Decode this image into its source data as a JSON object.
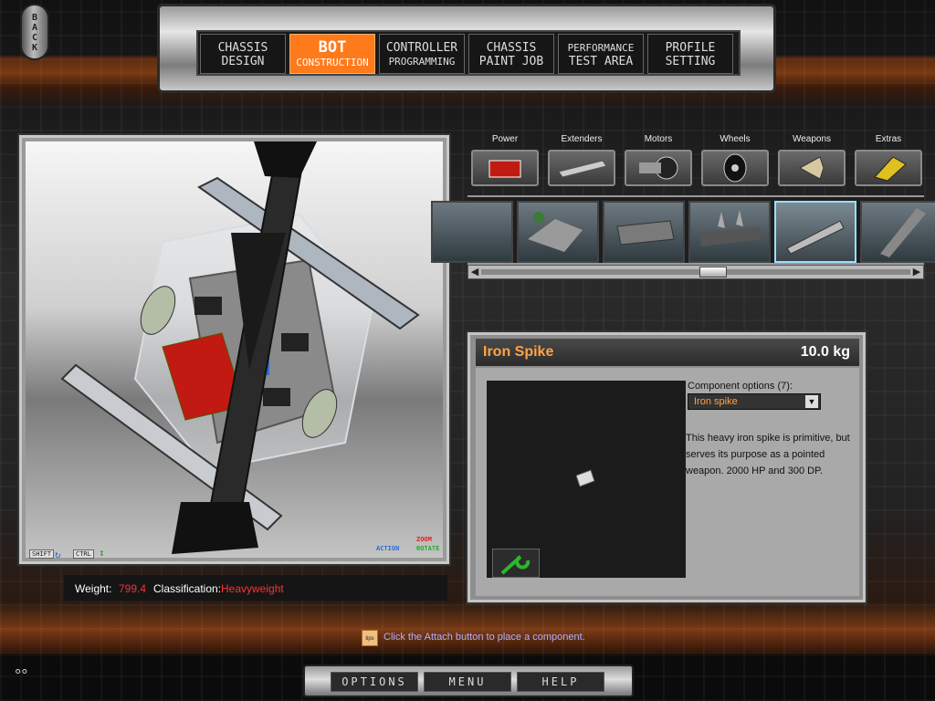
{
  "back_label": "BACK",
  "top_nav": {
    "tabs": [
      {
        "line1": "CHASSIS",
        "line2": "DESIGN",
        "active": false
      },
      {
        "line1": "BOT",
        "line2": "CONSTRUCTION",
        "active": true
      },
      {
        "line1": "CONTROLLER",
        "line2": "PROGRAMMING",
        "active": false
      },
      {
        "line1": "CHASSIS",
        "line2": "PAINT JOB",
        "active": false
      },
      {
        "line1": "PERFORMANCE",
        "line2": "TEST AREA",
        "active": false
      },
      {
        "line1": "PROFILE",
        "line2": "SETTING",
        "active": false
      }
    ]
  },
  "viewport": {
    "shift_key": "SHIFT",
    "ctrl_key": "CTRL",
    "action_label": "ACTION",
    "zoom_label": "ZOOM",
    "rotate_label": "ROTATE"
  },
  "status": {
    "weight_label": "Weight:",
    "weight_value": "799.4",
    "classification_label": "Classification:",
    "classification_value": "Heavyweight"
  },
  "categories": [
    "Power",
    "Extenders",
    "Motors",
    "Wheels",
    "Weapons",
    "Extras"
  ],
  "component": {
    "name": "Iron Spike",
    "weight": "10.0 kg",
    "options_label": "Component options (7):",
    "selected_option": "Iron spike",
    "description": "This heavy iron spike is primitive, but serves its purpose as a pointed weapon. 2000 HP and 300 DP."
  },
  "tip_icon": "tips",
  "tip_text": "Click the Attach button to place a component.",
  "bottom_nav": {
    "options": "OPTIONS",
    "menu": "MENU",
    "help": "HELP"
  },
  "corner_glyph": "°°",
  "colors": {
    "accent_orange": "#ff7a1a",
    "highlight_red": "#ff3030",
    "title_orange": "#ffa347",
    "tip_text": "#b0b0ff"
  }
}
